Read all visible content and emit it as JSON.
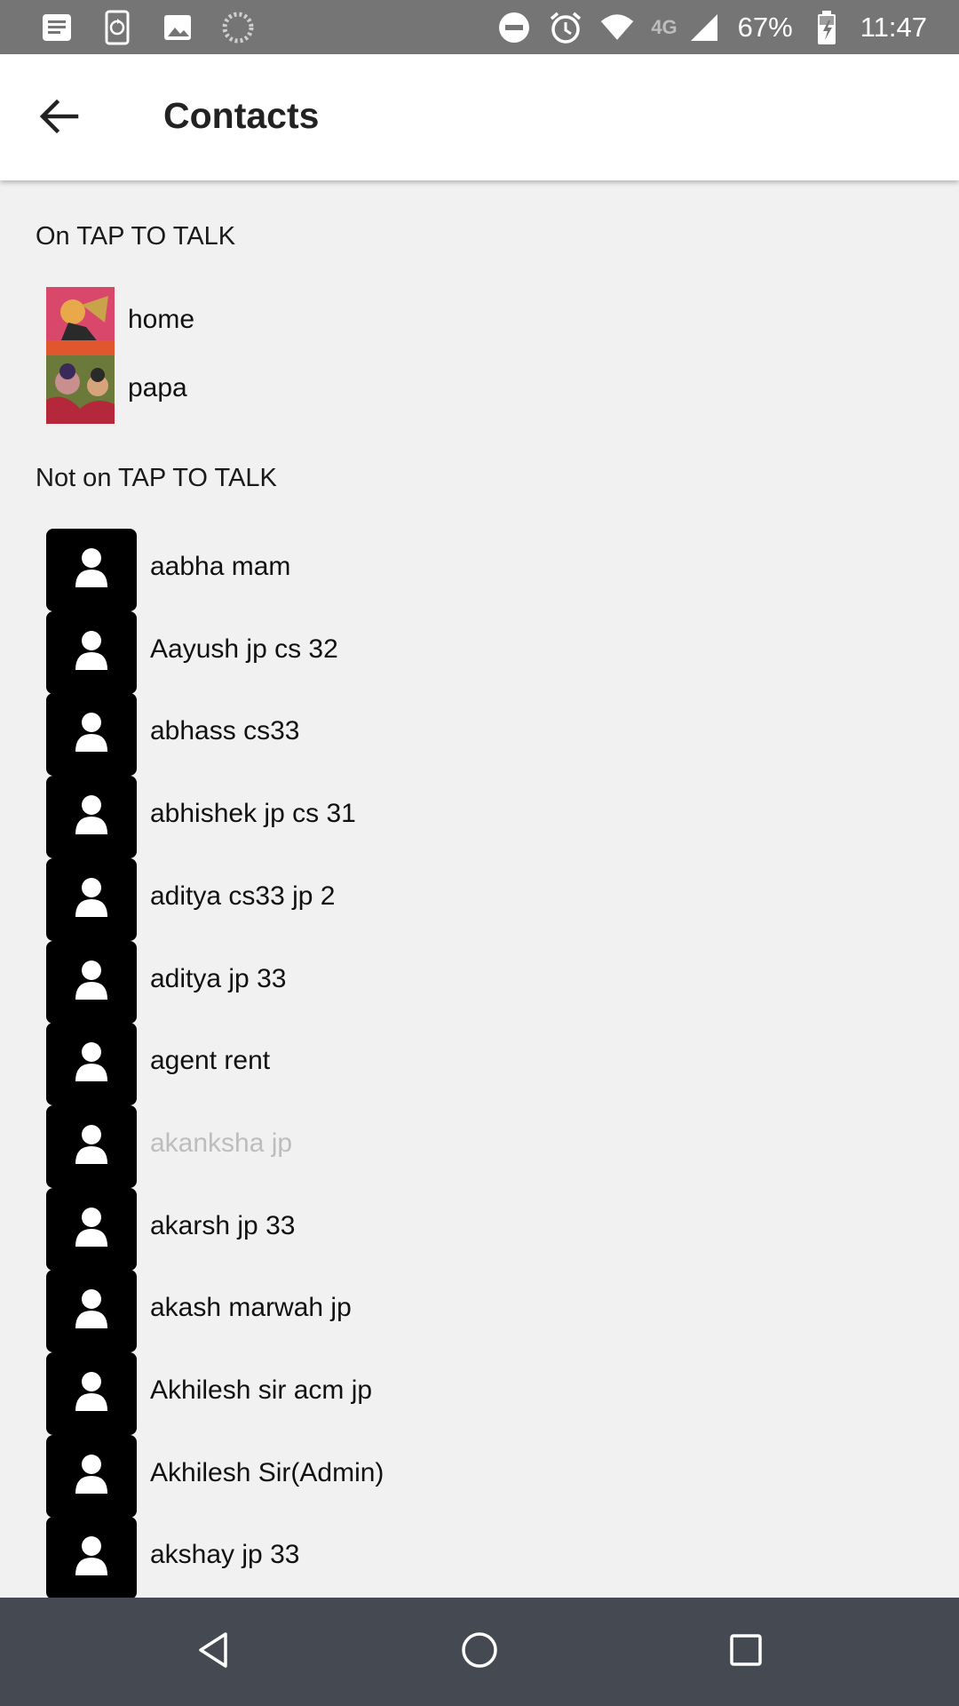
{
  "status_bar": {
    "battery_percent": "67%",
    "time": "11:47",
    "network": "4G",
    "left_icons": [
      "notes-icon",
      "phone-sync-icon",
      "image-icon",
      "loading-icon"
    ],
    "right_icons": [
      "dnd-icon",
      "alarm-icon",
      "wifi-icon",
      "signal-icon",
      "battery-charging-icon"
    ]
  },
  "app_bar": {
    "title": "Contacts",
    "back_icon": "arrow-left-icon"
  },
  "on_app": {
    "heading": "On TAP TO TALK",
    "items": [
      {
        "name": "home"
      },
      {
        "name": "papa"
      }
    ]
  },
  "not_on_app": {
    "heading": "Not on TAP TO TALK",
    "items": [
      {
        "name": "aabha mam"
      },
      {
        "name": "Aayush jp cs 32"
      },
      {
        "name": "abhass cs33"
      },
      {
        "name": "abhishek jp cs 31"
      },
      {
        "name": "aditya cs33 jp 2"
      },
      {
        "name": "aditya jp 33"
      },
      {
        "name": "agent rent"
      },
      {
        "name": "akanksha jp",
        "dimmed": true
      },
      {
        "name": "akarsh jp 33"
      },
      {
        "name": "akash marwah jp"
      },
      {
        "name": "Akhilesh sir acm jp"
      },
      {
        "name": "Akhilesh Sir(Admin)"
      },
      {
        "name": "akshay jp 33"
      }
    ]
  },
  "colors": {
    "status_bar": "#757575",
    "nav_bar": "#454a52",
    "background": "#f1f1f1",
    "avatar": "#000000",
    "dim_text": "#bdbdbd"
  },
  "nav_bar": {
    "icons": [
      "nav-back-icon",
      "nav-home-icon",
      "nav-recents-icon"
    ]
  }
}
